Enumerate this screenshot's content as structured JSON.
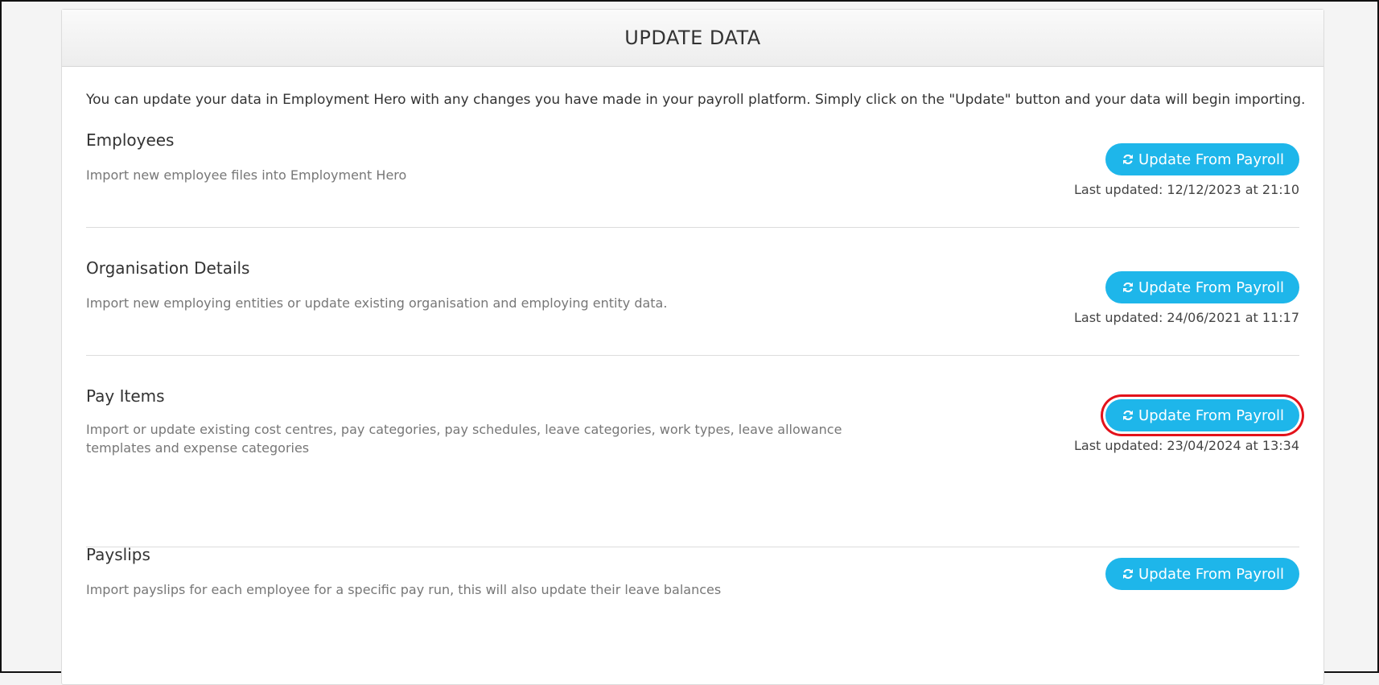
{
  "panel": {
    "title": "UPDATE DATA",
    "intro": "You can update your data in Employment Hero with any changes you have made in your payroll platform. Simply click on the \"Update\" button and your data will begin importing."
  },
  "sections": [
    {
      "title": "Employees",
      "description": "Import new employee files into Employment Hero",
      "button_label": "Update From Payroll",
      "button_icon": "refresh-icon",
      "last_updated": "Last updated: 12/12/2023 at 21:10"
    },
    {
      "title": "Organisation Details",
      "description": "Import new employing entities or update existing organisation and employing entity data.",
      "button_label": "Update From Payroll",
      "button_icon": "refresh-icon",
      "last_updated": "Last updated: 24/06/2021 at 11:17"
    },
    {
      "title": "Pay Items",
      "description": "Import or update existing cost centres, pay categories, pay schedules, leave categories, work types, leave allowance templates and expense categories",
      "button_label": "Update From Payroll",
      "button_icon": "refresh-icon",
      "last_updated": "Last updated: 23/04/2024 at 13:34",
      "highlighted": true
    },
    {
      "title": "Payslips",
      "description": "Import payslips for each employee for a specific pay run, this will also update their leave balances",
      "button_label": "Update From Payroll",
      "button_icon": "refresh-icon"
    }
  ],
  "colors": {
    "button": "#1eb6ea",
    "highlight_ring": "#e3121b",
    "divider": "#dcdcdc"
  }
}
